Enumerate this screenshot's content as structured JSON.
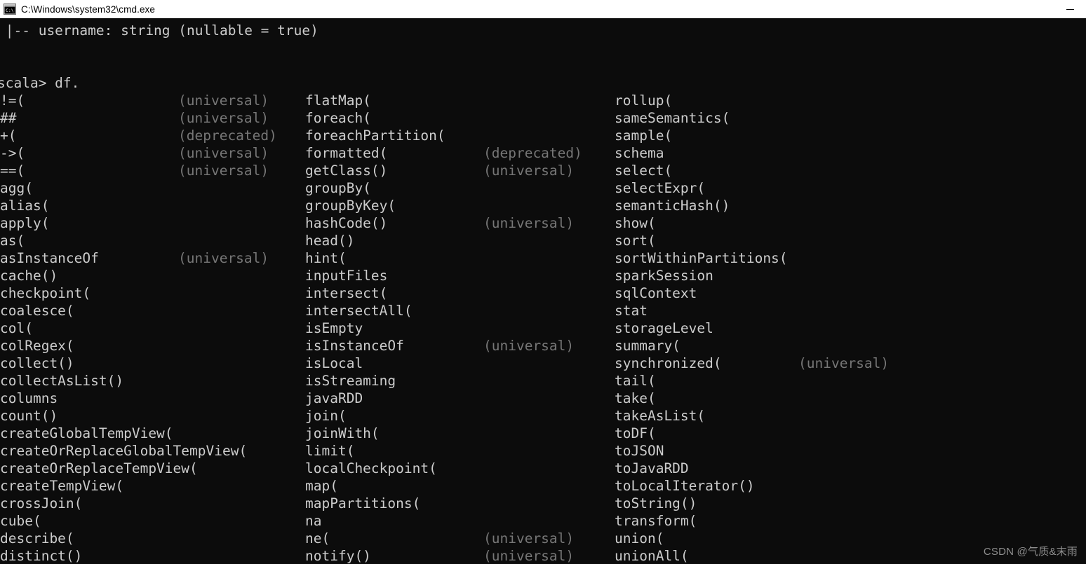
{
  "window": {
    "title": "C:\\Windows\\system32\\cmd.exe",
    "icon": "cmd-console-icon",
    "minimize_label": "—",
    "background_color": "#0c0c0c",
    "titlebar_color": "#ffffff",
    "text_color": "#cccccc",
    "dim_text_color": "#767676"
  },
  "terminal": {
    "schema_line": " |-- username: string (nullable = true)",
    "blank_line": "",
    "prompt_line": "scala> df.",
    "columns": {
      "col1_label": "members-column-1",
      "col2_label": "members-column-2",
      "col3_label": "members-column-3"
    },
    "rows": [
      {
        "c1": "!=(",
        "c1tag": "(universal)",
        "c2": "flatMap(",
        "c2tag": "",
        "c3": "rollup(",
        "c3tag": ""
      },
      {
        "c1": "##",
        "c1tag": "(universal)",
        "c2": "foreach(",
        "c2tag": "",
        "c3": "sameSemantics(",
        "c3tag": ""
      },
      {
        "c1": "+(",
        "c1tag": "(deprecated)",
        "c2": "foreachPartition(",
        "c2tag": "",
        "c3": "sample(",
        "c3tag": ""
      },
      {
        "c1": "->(",
        "c1tag": "(universal)",
        "c2": "formatted(",
        "c2tag": "(deprecated)",
        "c3": "schema",
        "c3tag": ""
      },
      {
        "c1": "==(",
        "c1tag": "(universal)",
        "c2": "getClass()",
        "c2tag": "(universal)",
        "c3": "select(",
        "c3tag": ""
      },
      {
        "c1": "agg(",
        "c1tag": "",
        "c2": "groupBy(",
        "c2tag": "",
        "c3": "selectExpr(",
        "c3tag": ""
      },
      {
        "c1": "alias(",
        "c1tag": "",
        "c2": "groupByKey(",
        "c2tag": "",
        "c3": "semanticHash()",
        "c3tag": ""
      },
      {
        "c1": "apply(",
        "c1tag": "",
        "c2": "hashCode()",
        "c2tag": "(universal)",
        "c3": "show(",
        "c3tag": ""
      },
      {
        "c1": "as(",
        "c1tag": "",
        "c2": "head()",
        "c2tag": "",
        "c3": "sort(",
        "c3tag": ""
      },
      {
        "c1": "asInstanceOf",
        "c1tag": "(universal)",
        "c2": "hint(",
        "c2tag": "",
        "c3": "sortWithinPartitions(",
        "c3tag": ""
      },
      {
        "c1": "cache()",
        "c1tag": "",
        "c2": "inputFiles",
        "c2tag": "",
        "c3": "sparkSession",
        "c3tag": ""
      },
      {
        "c1": "checkpoint(",
        "c1tag": "",
        "c2": "intersect(",
        "c2tag": "",
        "c3": "sqlContext",
        "c3tag": ""
      },
      {
        "c1": "coalesce(",
        "c1tag": "",
        "c2": "intersectAll(",
        "c2tag": "",
        "c3": "stat",
        "c3tag": ""
      },
      {
        "c1": "col(",
        "c1tag": "",
        "c2": "isEmpty",
        "c2tag": "",
        "c3": "storageLevel",
        "c3tag": ""
      },
      {
        "c1": "colRegex(",
        "c1tag": "",
        "c2": "isInstanceOf",
        "c2tag": "(universal)",
        "c3": "summary(",
        "c3tag": ""
      },
      {
        "c1": "collect()",
        "c1tag": "",
        "c2": "isLocal",
        "c2tag": "",
        "c3": "synchronized(",
        "c3tag": "(universal)"
      },
      {
        "c1": "collectAsList()",
        "c1tag": "",
        "c2": "isStreaming",
        "c2tag": "",
        "c3": "tail(",
        "c3tag": ""
      },
      {
        "c1": "columns",
        "c1tag": "",
        "c2": "javaRDD",
        "c2tag": "",
        "c3": "take(",
        "c3tag": ""
      },
      {
        "c1": "count()",
        "c1tag": "",
        "c2": "join(",
        "c2tag": "",
        "c3": "takeAsList(",
        "c3tag": ""
      },
      {
        "c1": "createGlobalTempView(",
        "c1tag": "",
        "c2": "joinWith(",
        "c2tag": "",
        "c3": "toDF(",
        "c3tag": ""
      },
      {
        "c1": "createOrReplaceGlobalTempView(",
        "c1tag": "",
        "c2": "limit(",
        "c2tag": "",
        "c3": "toJSON",
        "c3tag": ""
      },
      {
        "c1": "createOrReplaceTempView(",
        "c1tag": "",
        "c2": "localCheckpoint(",
        "c2tag": "",
        "c3": "toJavaRDD",
        "c3tag": ""
      },
      {
        "c1": "createTempView(",
        "c1tag": "",
        "c2": "map(",
        "c2tag": "",
        "c3": "toLocalIterator()",
        "c3tag": ""
      },
      {
        "c1": "crossJoin(",
        "c1tag": "",
        "c2": "mapPartitions(",
        "c2tag": "",
        "c3": "toString()",
        "c3tag": ""
      },
      {
        "c1": "cube(",
        "c1tag": "",
        "c2": "na",
        "c2tag": "",
        "c3": "transform(",
        "c3tag": ""
      },
      {
        "c1": "describe(",
        "c1tag": "",
        "c2": "ne(",
        "c2tag": "(universal)",
        "c3": "union(",
        "c3tag": ""
      },
      {
        "c1": "distinct()",
        "c1tag": "",
        "c2": "notify()",
        "c2tag": "(universal)",
        "c3": "unionAll(",
        "c3tag": ""
      }
    ]
  },
  "watermark": {
    "text": "CSDN @气质&末雨"
  }
}
